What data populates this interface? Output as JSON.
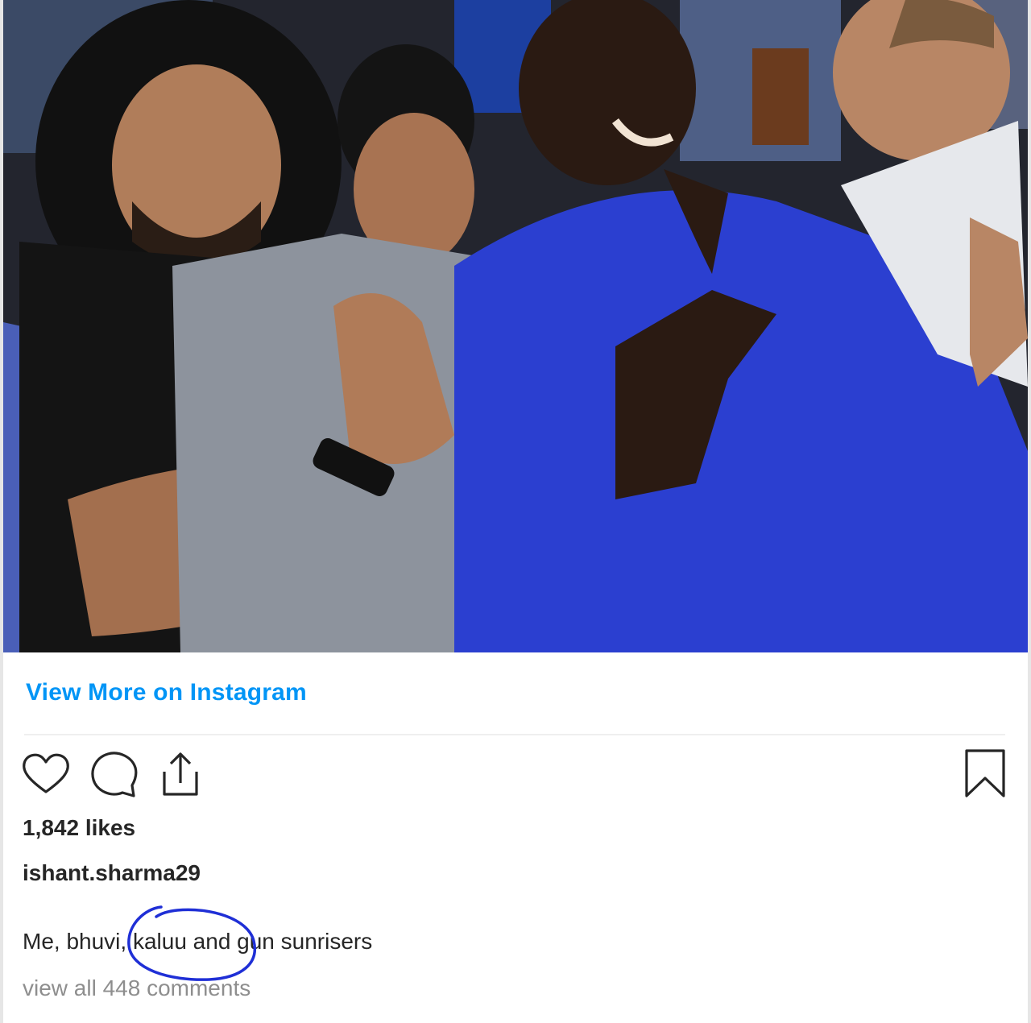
{
  "post": {
    "view_more_label": "View More on Instagram",
    "likes_text": "1,842 likes",
    "username": "ishant.sharma29",
    "caption": "Me, bhuvi, kaluu and gun sunrisers",
    "view_comments_label": "view all 448 comments"
  },
  "colors": {
    "link": "#0095f6",
    "text": "#262626",
    "muted": "#8e8e8e",
    "annotation": "#1f2fd6"
  },
  "icons": [
    "heart-icon",
    "comment-icon",
    "share-icon",
    "bookmark-icon"
  ]
}
